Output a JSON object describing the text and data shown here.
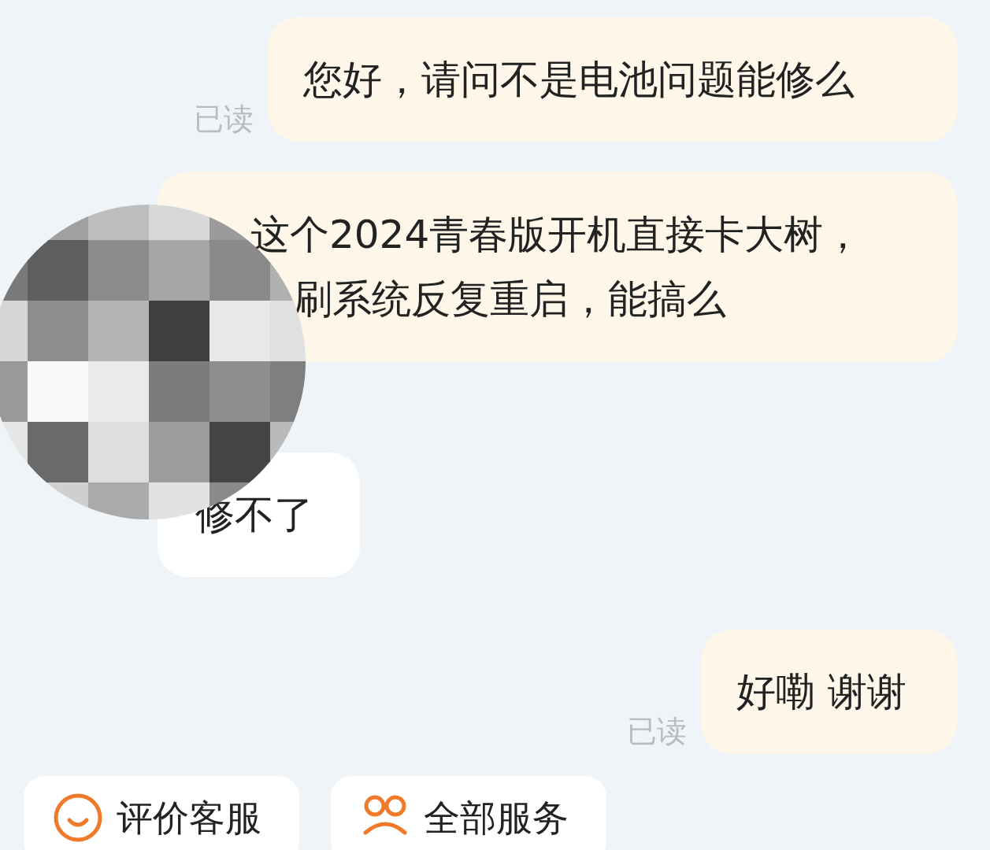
{
  "messages": [
    {
      "kind": "outgoing",
      "read_label": "已读",
      "lines": [
        "您好，请问不是电池问题能修么"
      ]
    },
    {
      "kind": "outgoing",
      "lines": [
        "这个2024青春版开机直接卡大树，",
        "刷系统反复重启，能搞么"
      ]
    },
    {
      "kind": "incoming",
      "lines": [
        "修不了"
      ]
    },
    {
      "kind": "outgoing",
      "read_label": "已读",
      "lines": [
        "好嘞 谢谢"
      ]
    }
  ],
  "actions": [
    {
      "kind": "smiley",
      "label": "评价客服"
    },
    {
      "kind": "group",
      "label": "全部服务"
    }
  ]
}
